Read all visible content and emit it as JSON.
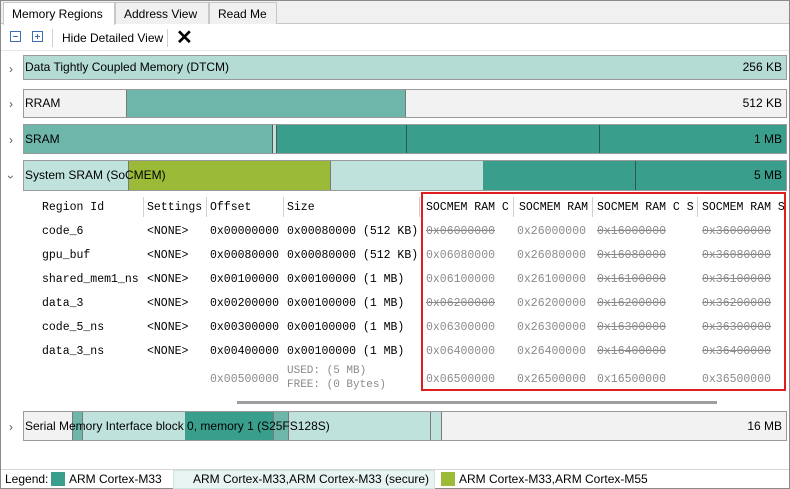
{
  "tabs": [
    {
      "label": "Memory Regions"
    },
    {
      "label": "Address View"
    },
    {
      "label": "Read Me"
    }
  ],
  "toolbar": {
    "collapse_icon": "collapse-all-icon",
    "expand_icon": "expand-all-icon",
    "hide_detailed_label": "Hide Detailed View",
    "clear_icon": "close-icon"
  },
  "colors": {
    "cortex_m33": "#3a9e8c",
    "cortex_m33_secure": "#bfe3dc",
    "cortex_m33_m55": "#9aba38",
    "mid_teal": "#6fb6aa",
    "dtcm": "#b5dcd4"
  },
  "regions": [
    {
      "name": "Data Tightly Coupled Memory (DTCM)",
      "size": "256 KB"
    },
    {
      "name": "RRAM",
      "size": "512 KB"
    },
    {
      "name": "SRAM",
      "size": "1 MB"
    },
    {
      "name": "System SRAM (SoCMEM)",
      "size": "5 MB"
    },
    {
      "name": "Serial Memory Interface block 0, memory 1 (S25FS128S)",
      "size": "16 MB"
    }
  ],
  "table": {
    "headers": [
      "Region Id",
      "Settings",
      "Offset",
      "Size",
      "SOCMEM RAM C",
      "SOCMEM RAM",
      "SOCMEM RAM C S",
      "SOCMEM RAM S"
    ],
    "rows": [
      {
        "id": "code_6",
        "settings": "<NONE>",
        "offset": "0x00000000",
        "size": "0x00080000 (512 KB)",
        "a1": "0x06000000",
        "a2": "0x26000000",
        "a3": "0x16000000",
        "a4": "0x36000000"
      },
      {
        "id": "gpu_buf",
        "settings": "<NONE>",
        "offset": "0x00080000",
        "size": "0x00080000 (512 KB)",
        "a1": "0x06080000",
        "a2": "0x26080000",
        "a3": "0x16080000",
        "a4": "0x36080000"
      },
      {
        "id": "shared_mem1_ns",
        "settings": "<NONE>",
        "offset": "0x00100000",
        "size": "0x00100000 (1 MB)",
        "a1": "0x06100000",
        "a2": "0x26100000",
        "a3": "0x16100000",
        "a4": "0x36100000"
      },
      {
        "id": "data_3",
        "settings": "<NONE>",
        "offset": "0x00200000",
        "size": "0x00100000 (1 MB)",
        "a1": "0x06200000",
        "a2": "0x26200000",
        "a3": "0x16200000",
        "a4": "0x36200000"
      },
      {
        "id": "code_5_ns",
        "settings": "<NONE>",
        "offset": "0x00300000",
        "size": "0x00100000 (1 MB)",
        "a1": "0x06300000",
        "a2": "0x26300000",
        "a3": "0x16300000",
        "a4": "0x36300000"
      },
      {
        "id": "data_3_ns",
        "settings": "<NONE>",
        "offset": "0x00400000",
        "size": "0x00100000 (1 MB)",
        "a1": "0x06400000",
        "a2": "0x26400000",
        "a3": "0x16400000",
        "a4": "0x36400000"
      }
    ],
    "free_row": {
      "offset": "0x00500000",
      "used": "USED: (5 MB)",
      "free": "FREE: (0 Bytes)",
      "a1": "0x06500000",
      "a2": "0x26500000",
      "a3": "0x16500000",
      "a4": "0x36500000"
    }
  },
  "legend": {
    "label": "Legend:",
    "items": [
      {
        "label": "ARM Cortex-M33",
        "color": "#3a9e8c"
      },
      {
        "label": "ARM Cortex-M33,ARM Cortex-M33 (secure)",
        "color": "#bfe3dc"
      },
      {
        "label": "ARM Cortex-M33,ARM Cortex-M55",
        "color": "#9aba38"
      }
    ]
  }
}
